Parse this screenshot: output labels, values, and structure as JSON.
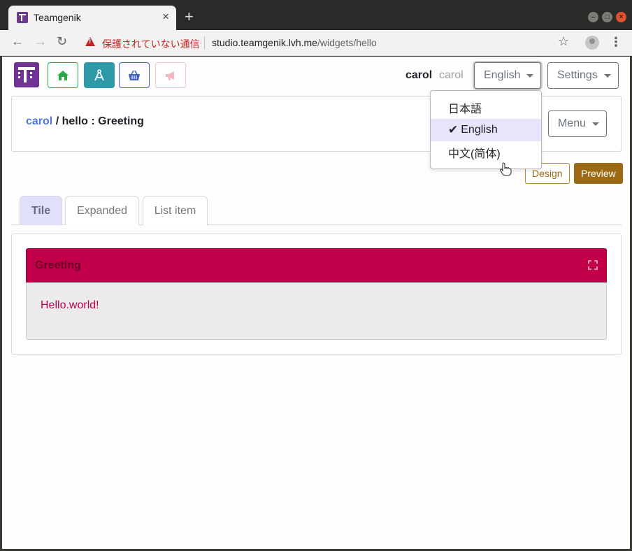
{
  "browser": {
    "tab_title": "Teamgenik",
    "new_tab": "+",
    "insecure_label": "保護されていない通信",
    "url_host": "studio.teamgenik.lvh.me",
    "url_path": "/widgets/hello"
  },
  "header": {
    "user_name": "carol",
    "user_login": "carol",
    "language_button": "English",
    "settings_button": "Settings"
  },
  "language_menu": {
    "items": [
      "日本語",
      "English",
      "中文(简体)"
    ],
    "selected": "English"
  },
  "breadcrumb": {
    "owner": "carol",
    "rest": " / hello : Greeting"
  },
  "panel": {
    "menu_button": "Menu",
    "design_button": "Design",
    "preview_button": "Preview"
  },
  "tabs": [
    "Tile",
    "Expanded",
    "List item"
  ],
  "widget": {
    "title": "Greeting",
    "body_text": "Hello.world!"
  },
  "colors": {
    "brand": "#6f3393",
    "widget_accent": "#c2004a",
    "preview_button": "#9c6a14"
  }
}
